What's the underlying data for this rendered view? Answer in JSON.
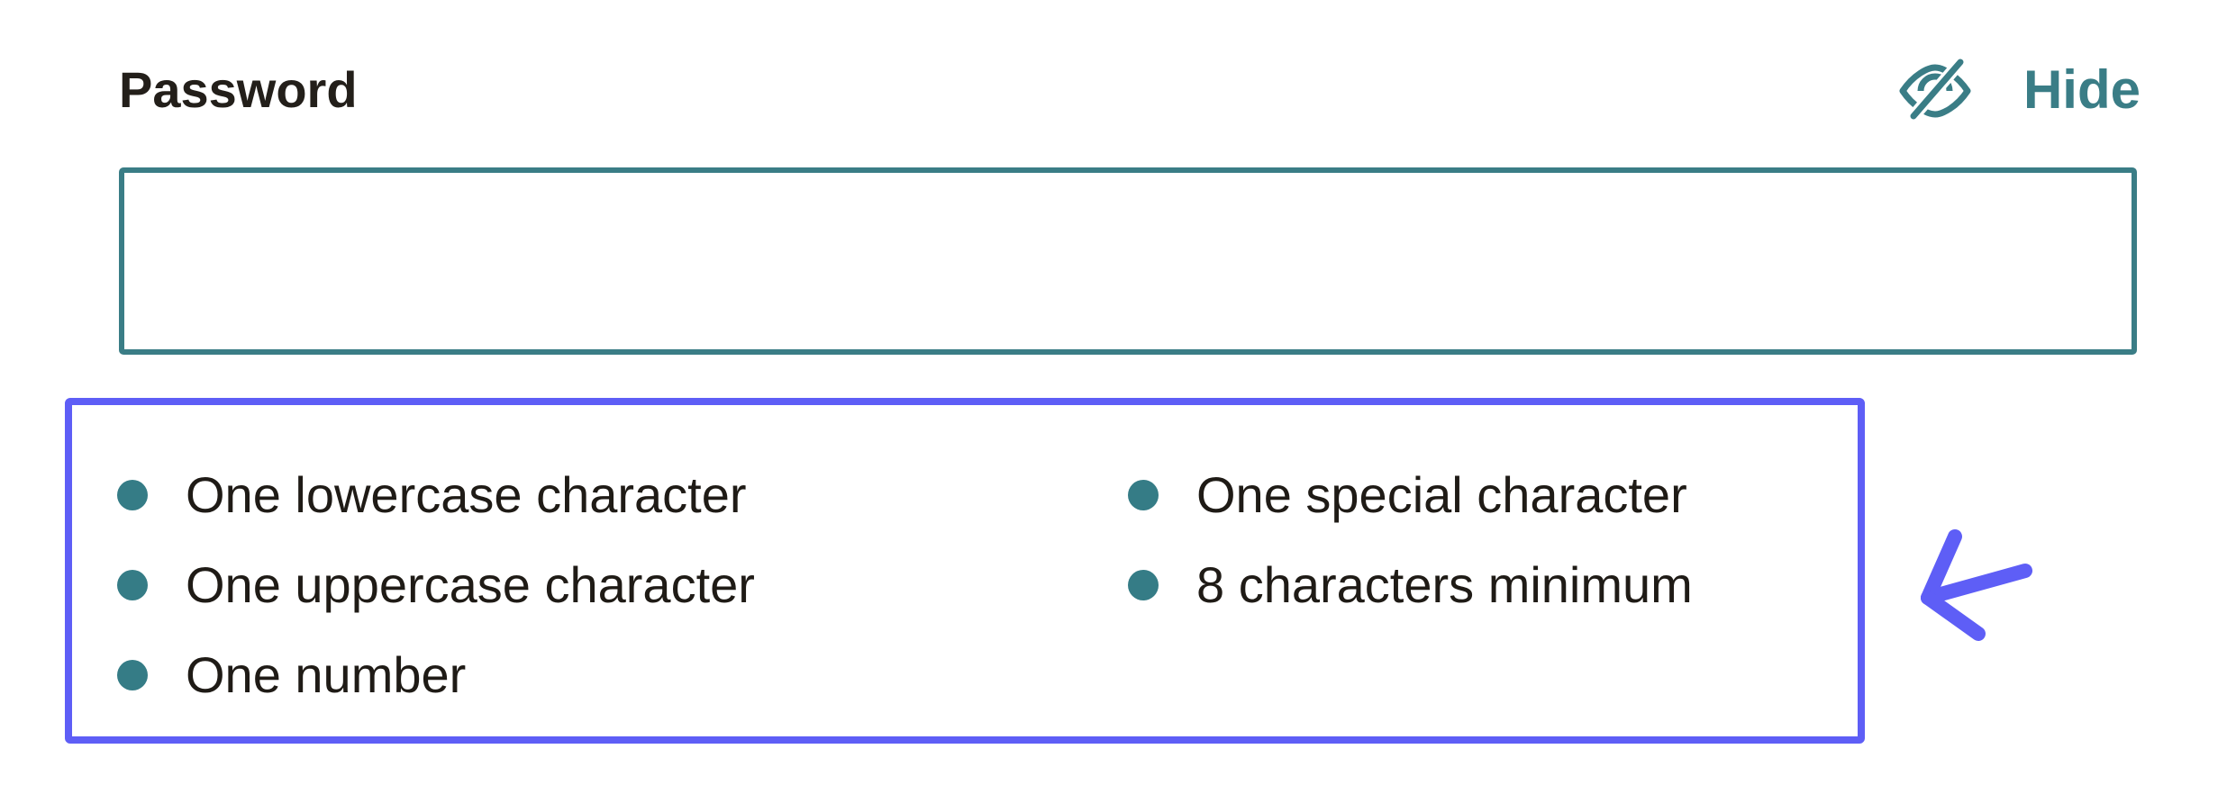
{
  "password_field": {
    "label": "Password",
    "toggle_label": "Hide",
    "toggle_icon": "eye-slash-icon",
    "value": "",
    "placeholder": ""
  },
  "requirements": {
    "items": [
      {
        "text": "One lowercase character"
      },
      {
        "text": "One uppercase character"
      },
      {
        "text": "One number"
      },
      {
        "text": "One special character"
      },
      {
        "text": "8 characters minimum"
      }
    ],
    "bullet_color": "#357c86"
  },
  "annotation": {
    "highlight_color": "#5e5ef6",
    "arrow_icon": "arrow-left-icon"
  },
  "colors": {
    "accent": "#3a7d86",
    "text": "#1f1b16"
  }
}
